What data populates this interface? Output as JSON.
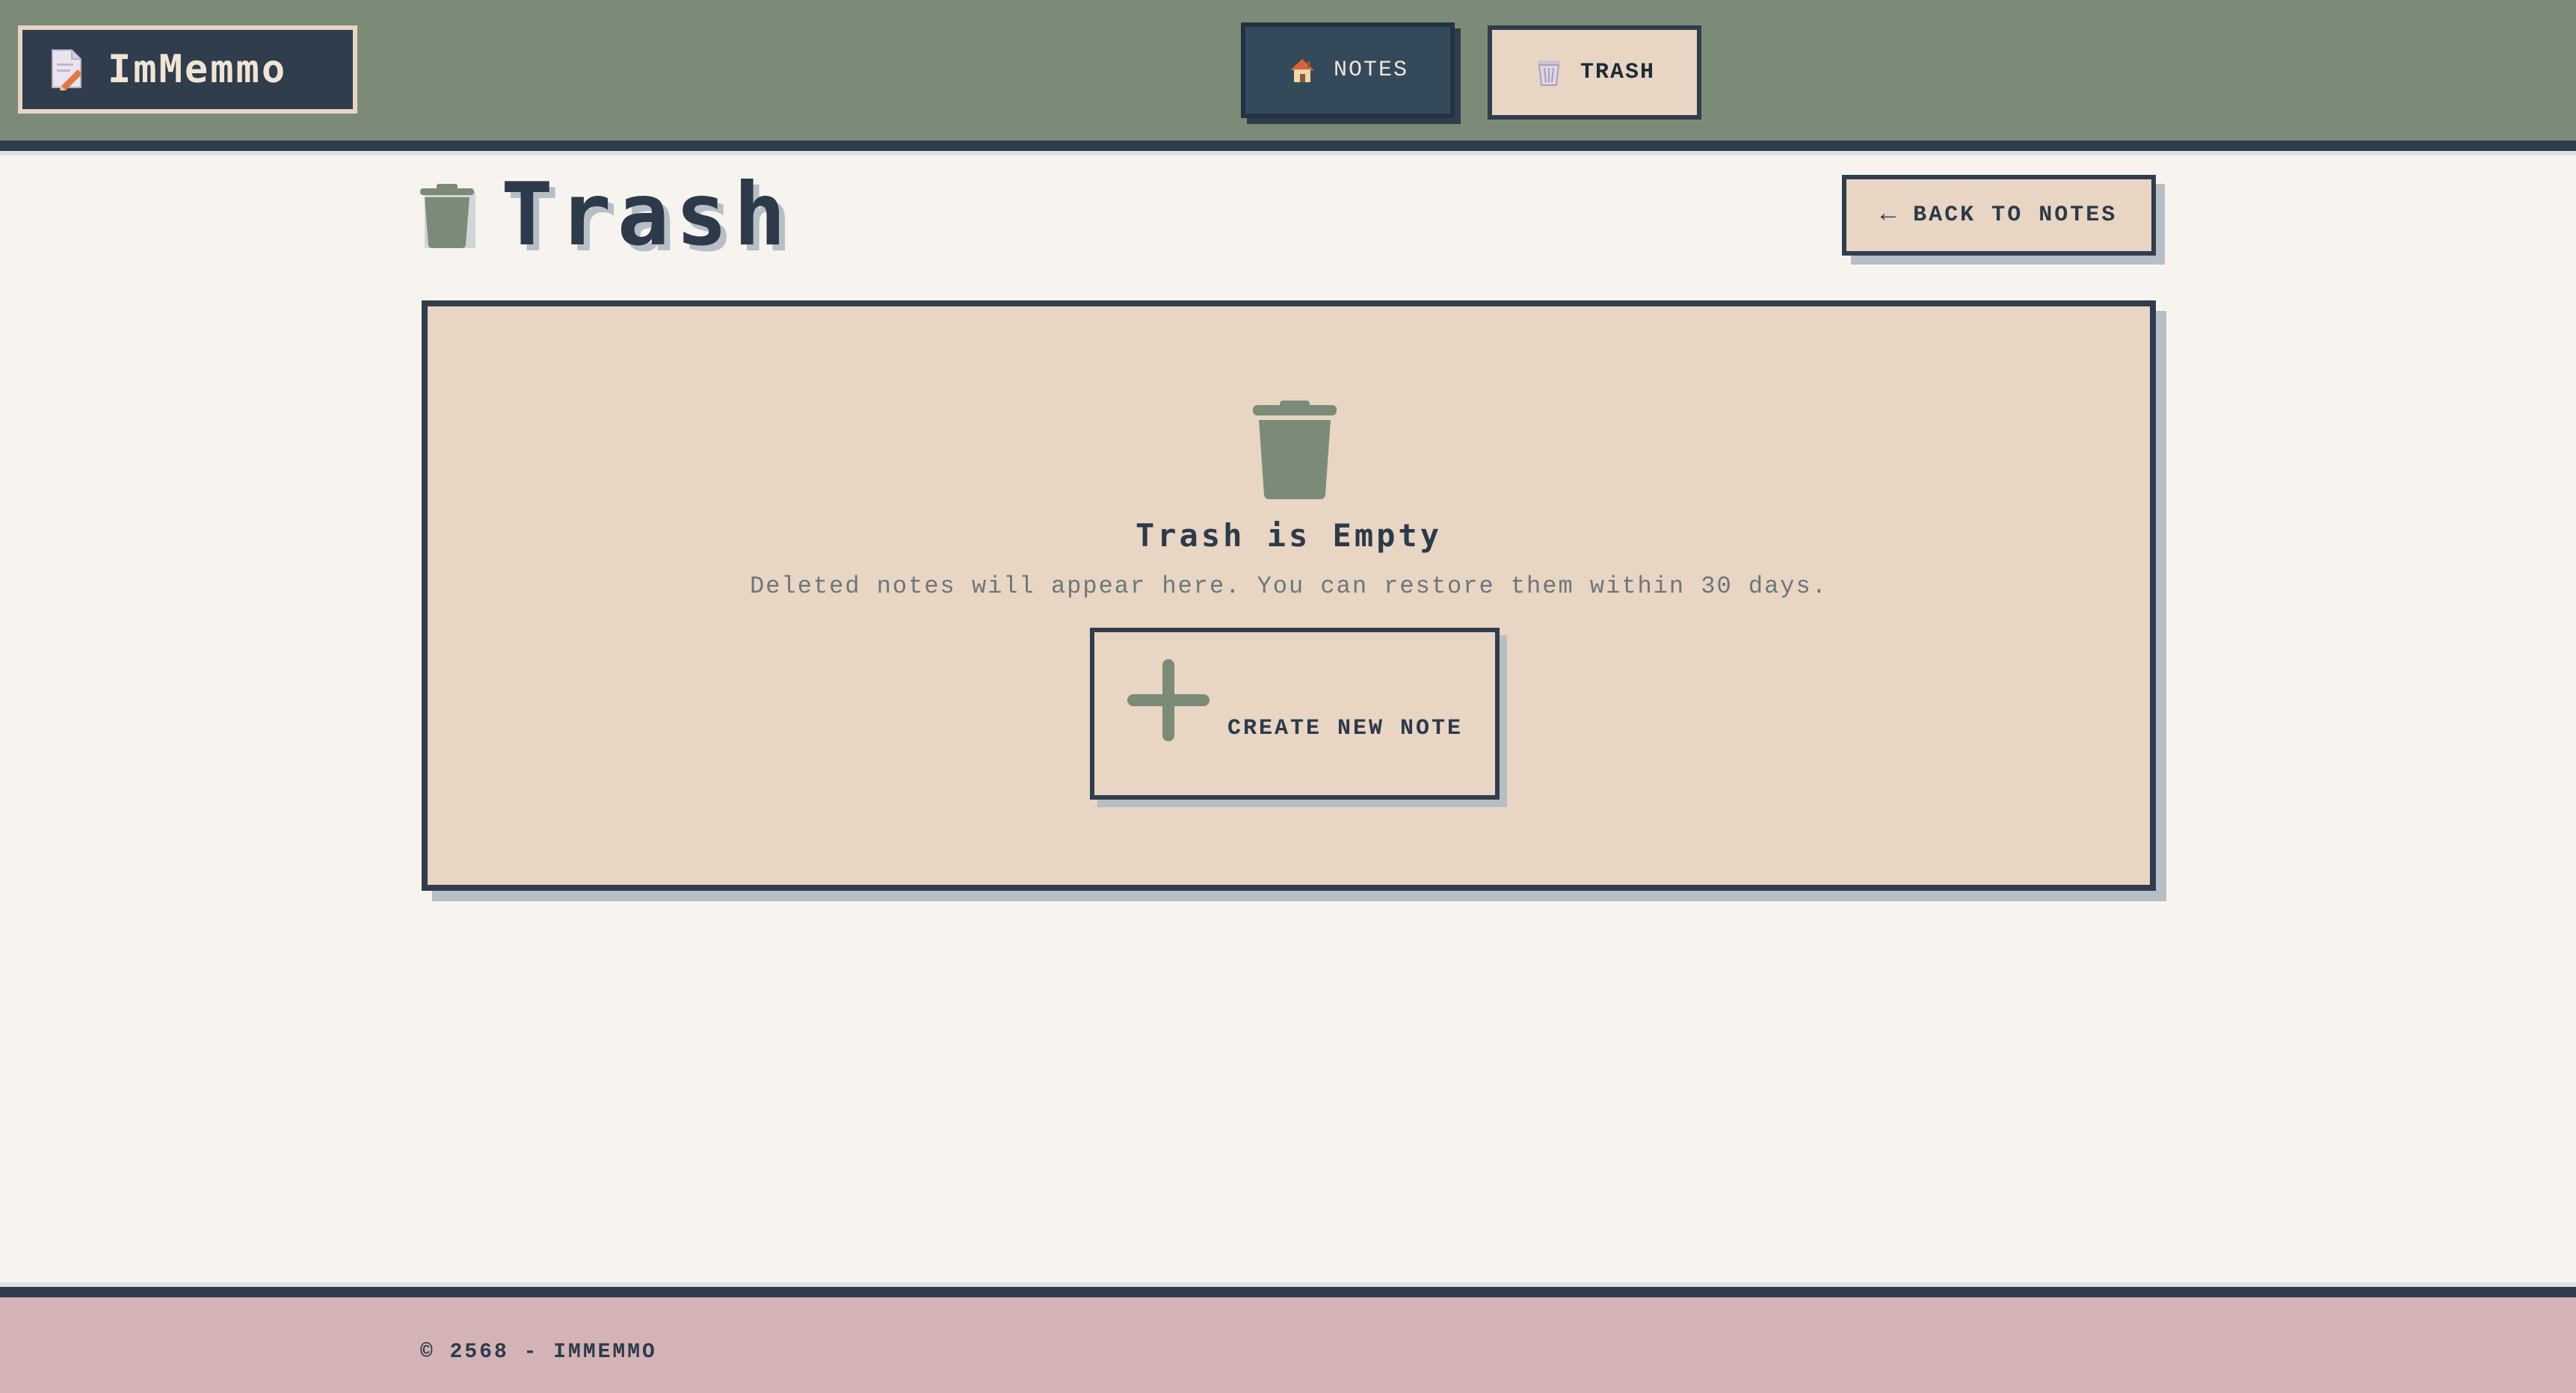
{
  "app": {
    "name": "ImMemmo",
    "logo_icon": "memo-pencil-icon"
  },
  "nav": {
    "notes": {
      "label": "NOTES",
      "icon": "house-icon"
    },
    "trash": {
      "label": "TRASH",
      "icon": "wastebasket-icon",
      "active": true
    }
  },
  "page": {
    "title": "Trash",
    "title_icon": "trash-icon",
    "back_label": "BACK TO NOTES",
    "back_icon": "arrow-left-icon"
  },
  "empty_state": {
    "icon": "trash-icon",
    "title": "Trash is Empty",
    "subtitle": "Deleted notes will appear here. You can restore them within 30 days.",
    "create_label": "CREATE NEW NOTE",
    "create_icon": "plus-icon"
  },
  "footer": {
    "text": "© 2568 - IMMEMMO"
  },
  "colors": {
    "header_bg": "#7b8b78",
    "navy": "#2f3d4c",
    "sand": "#e8d5c3",
    "page_bg": "#f7f4ef",
    "sage_icon": "#7b8b78",
    "footer_bg": "#d4b3b6"
  }
}
